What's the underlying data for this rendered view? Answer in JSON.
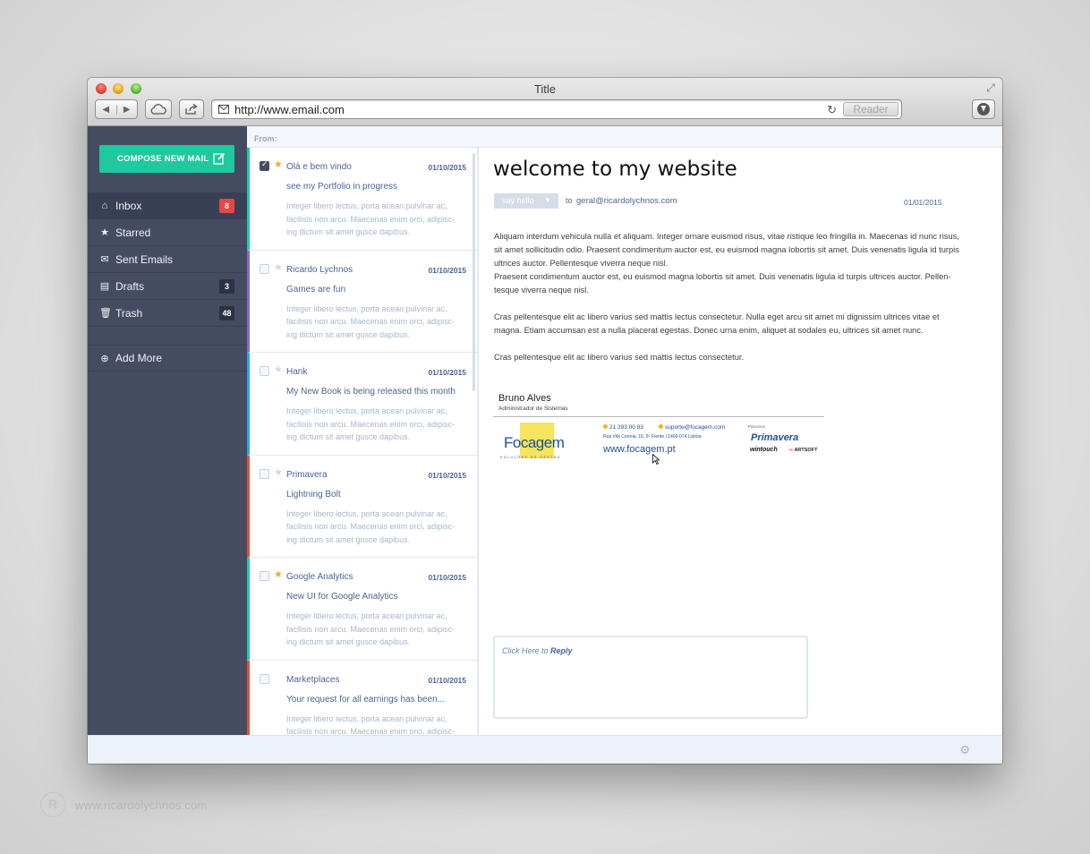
{
  "window": {
    "title": "Title",
    "url": "http://www.email.com",
    "reader_label": "Reader"
  },
  "sidebar": {
    "compose_label": "COMPOSE NEW MAIL",
    "items": [
      {
        "label": "Inbox",
        "badge": "8"
      },
      {
        "label": "Starred",
        "badge": ""
      },
      {
        "label": "Sent Emails",
        "badge": ""
      },
      {
        "label": "Drafts",
        "badge": "3"
      },
      {
        "label": "Trash",
        "badge": "48"
      }
    ],
    "add_more_label": "Add More"
  },
  "list": {
    "header_label": "From:",
    "emails": [
      {
        "sender": "Olá e bem vindo",
        "date": "01/10/2015",
        "subject": "see my Portfolio in progress",
        "preview": "Integer libero lectus, porta acean pulvinar ac, facilisis non arcu. Maecenas enim orci, adipisc-ing dictum sit amet gusce dapibus.",
        "checked": true,
        "starred": true,
        "accent": "#1fc9a0"
      },
      {
        "sender": "Ricardo Lychnos",
        "date": "01/10/2015",
        "subject": "Games are fun",
        "preview": "Integer libero lectus, porta acean pulvinar ac, facilisis non arcu. Maecenas enim orci, adipisc-ing dictum sit amet gusce dapibus.",
        "checked": false,
        "starred": false,
        "accent": "#8a6bc2"
      },
      {
        "sender": "Hank",
        "date": "01/10/2015",
        "subject": "My New Book is being released this month",
        "preview": "Integer libero lectus, porta acean pulvinar ac, facilisis non arcu. Maecenas enim orci, adipisc-ing dictum sit amet gusce dapibus.",
        "checked": false,
        "starred": false,
        "accent": "#2aa7e0"
      },
      {
        "sender": "Primavera",
        "date": "01/10/2015",
        "subject": "Lightning Bolt",
        "preview": "Integer libero lectus, porta acean pulvinar ac, facilisis non arcu. Maecenas enim orci, adipisc-ing dictum sit amet gusce dapibus.",
        "checked": false,
        "starred": false,
        "accent": "#e0503a"
      },
      {
        "sender": "Google Analytics",
        "date": "01/10/2015",
        "subject": "New UI for Google Analytics",
        "preview": "Integer libero lectus, porta acean pulvinar ac, facilisis non arcu. Maecenas enim orci, adipisc-ing dictum sit amet gusce dapibus.",
        "checked": false,
        "starred": true,
        "accent": "#1fc9a0"
      },
      {
        "sender": "Marketplaces",
        "date": "01/10/2015",
        "subject": "Your request for all earnings has been...",
        "preview": "Integer libero lectus, porta acean pulvinar ac, facilisis non arcu. Maecenas enim orci, adipisc-ing dictum sit amet gusce dapibus.",
        "checked": false,
        "starred": null,
        "accent": "#e0503a"
      }
    ]
  },
  "message": {
    "title": "welcome to my website",
    "action_label": "say hello",
    "to_label": "to",
    "to_address": "geral@ricardolychnos.com",
    "date": "01/01/2015",
    "paragraphs": [
      "Aliquam interdum vehicula nulla et aliquam. Integer ornare euismod risus, vitae ristique leo fringilla in. Maecenas id nunc risus, sit amet sollicitudin odio. Praesent condimentum auctor est, eu euismod magna lobortis sit amet. Duis venenatis ligula id turpis ultrices auctor. Pellentesque viverra neque nisl.",
      "Praesent condimentum auctor est, eu euismod magna lobortis sit amet. Duis venenatis ligula id turpis ultrices auctor. Pellen-tesque viverra neque nisl.",
      "Cras pellentesque elit ac libero varius sed mattis lectus consectetur. Nulla eget arcu sit amet mi dignissim ultrices vitae et magna. Etiam accumsan est a nulla placerat egestas. Donec urna enim, aliquet at sodales eu, ultrices sit amet nunc.",
      "Cras pellentesque elit ac libero varius sed mattis lectus consectetur."
    ],
    "signature": {
      "name": "Bruno Alves",
      "role": "Administrador de Sistemas",
      "company": "Focagem",
      "company_tagline": "SOLUÇÕES DE GESTÃO",
      "phone": "21 393 00 83",
      "email": "suporte@focagem.com",
      "address": "Rua Vila Correia, 16, 5º Frente | 1400-074 Lisboa",
      "website": "www.focagem.pt",
      "partners_label": "Parceiros",
      "partner_1": "Primavera",
      "partner_2": "wintouch",
      "partner_3": "ARTSOFT"
    },
    "reply_prefix": "Click Here to ",
    "reply_action": "Reply"
  },
  "watermark": {
    "logo": "R",
    "text": "www.ricardolychnos.com"
  },
  "icons": {
    "back": "back-arrow-icon",
    "forward": "forward-arrow-icon",
    "cloud": "cloud-icon",
    "share": "share-icon",
    "reload": "reload-icon",
    "download": "download-icon",
    "compose": "edit-icon",
    "settings": "gear-icon"
  }
}
